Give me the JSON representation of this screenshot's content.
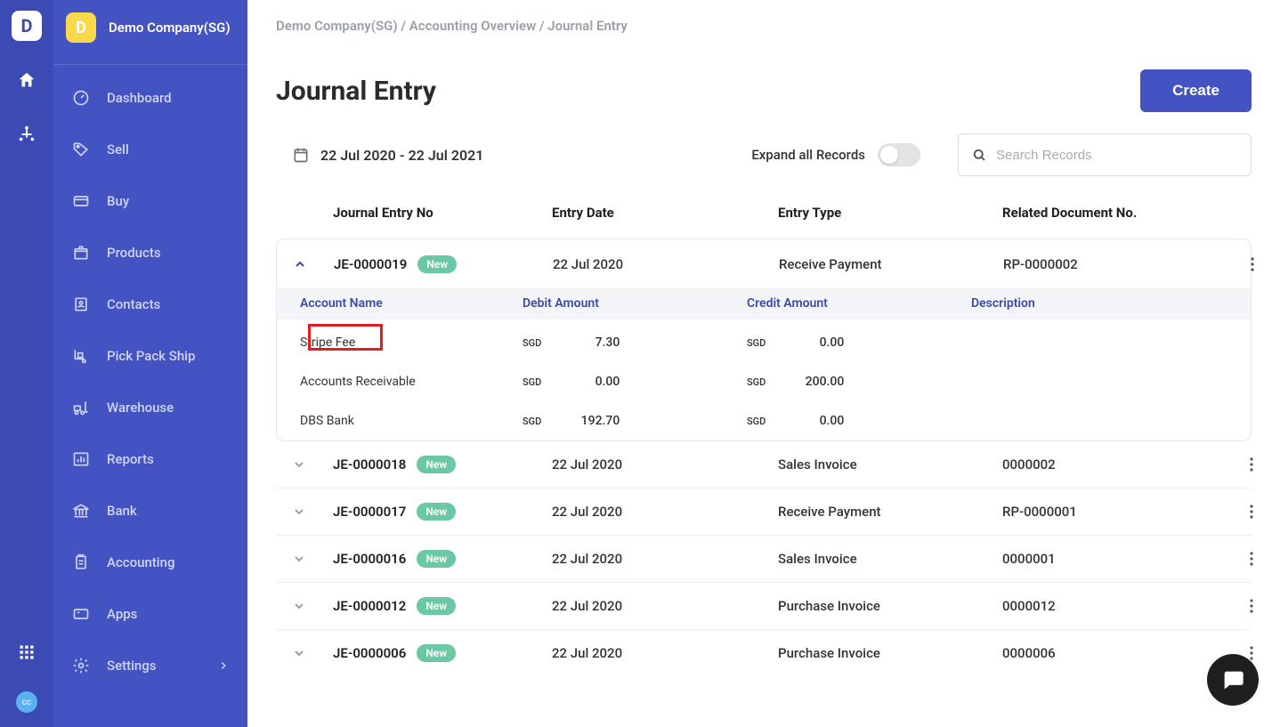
{
  "org": {
    "badge_letter": "D",
    "name": "Demo Company(SG)"
  },
  "sidebar": {
    "items": [
      {
        "label": "Dashboard"
      },
      {
        "label": "Sell"
      },
      {
        "label": "Buy"
      },
      {
        "label": "Products"
      },
      {
        "label": "Contacts"
      },
      {
        "label": "Pick Pack Ship"
      },
      {
        "label": "Warehouse"
      },
      {
        "label": "Reports"
      },
      {
        "label": "Bank"
      },
      {
        "label": "Accounting"
      },
      {
        "label": "Apps"
      },
      {
        "label": "Settings"
      }
    ]
  },
  "breadcrumb": "Demo Company(SG) / Accounting Overview / Journal Entry",
  "page": {
    "title": "Journal Entry",
    "create_label": "Create"
  },
  "filters": {
    "date_range": "22 Jul 2020 - 22 Jul 2021",
    "expand_label": "Expand all Records",
    "search_placeholder": "Search Records"
  },
  "columns": {
    "c1": "Journal Entry No",
    "c2": "Entry Date",
    "c3": "Entry Type",
    "c4": "Related Document No."
  },
  "sub_columns": {
    "a": "Account Name",
    "b": "Debit Amount",
    "c": "Credit Amount",
    "d": "Description"
  },
  "rows": [
    {
      "no": "JE-0000019",
      "badge": "New",
      "date": "22 Jul 2020",
      "type": "Receive Payment",
      "doc": "RP-0000002",
      "expanded": true,
      "lines": [
        {
          "acct": "Stripe Fee",
          "dc": "SGD",
          "d": "7.30",
          "cc": "SGD",
          "c": "0.00"
        },
        {
          "acct": "Accounts Receivable",
          "dc": "SGD",
          "d": "0.00",
          "cc": "SGD",
          "c": "200.00"
        },
        {
          "acct": "DBS Bank",
          "dc": "SGD",
          "d": "192.70",
          "cc": "SGD",
          "c": "0.00"
        }
      ]
    },
    {
      "no": "JE-0000018",
      "badge": "New",
      "date": "22 Jul 2020",
      "type": "Sales Invoice",
      "doc": "0000002",
      "expanded": false
    },
    {
      "no": "JE-0000017",
      "badge": "New",
      "date": "22 Jul 2020",
      "type": "Receive Payment",
      "doc": "RP-0000001",
      "expanded": false
    },
    {
      "no": "JE-0000016",
      "badge": "New",
      "date": "22 Jul 2020",
      "type": "Sales Invoice",
      "doc": "0000001",
      "expanded": false
    },
    {
      "no": "JE-0000012",
      "badge": "New",
      "date": "22 Jul 2020",
      "type": "Purchase Invoice",
      "doc": "0000012",
      "expanded": false
    },
    {
      "no": "JE-0000006",
      "badge": "New",
      "date": "22 Jul 2020",
      "type": "Purchase Invoice",
      "doc": "0000006",
      "expanded": false
    }
  ],
  "cc_badge": "cc"
}
